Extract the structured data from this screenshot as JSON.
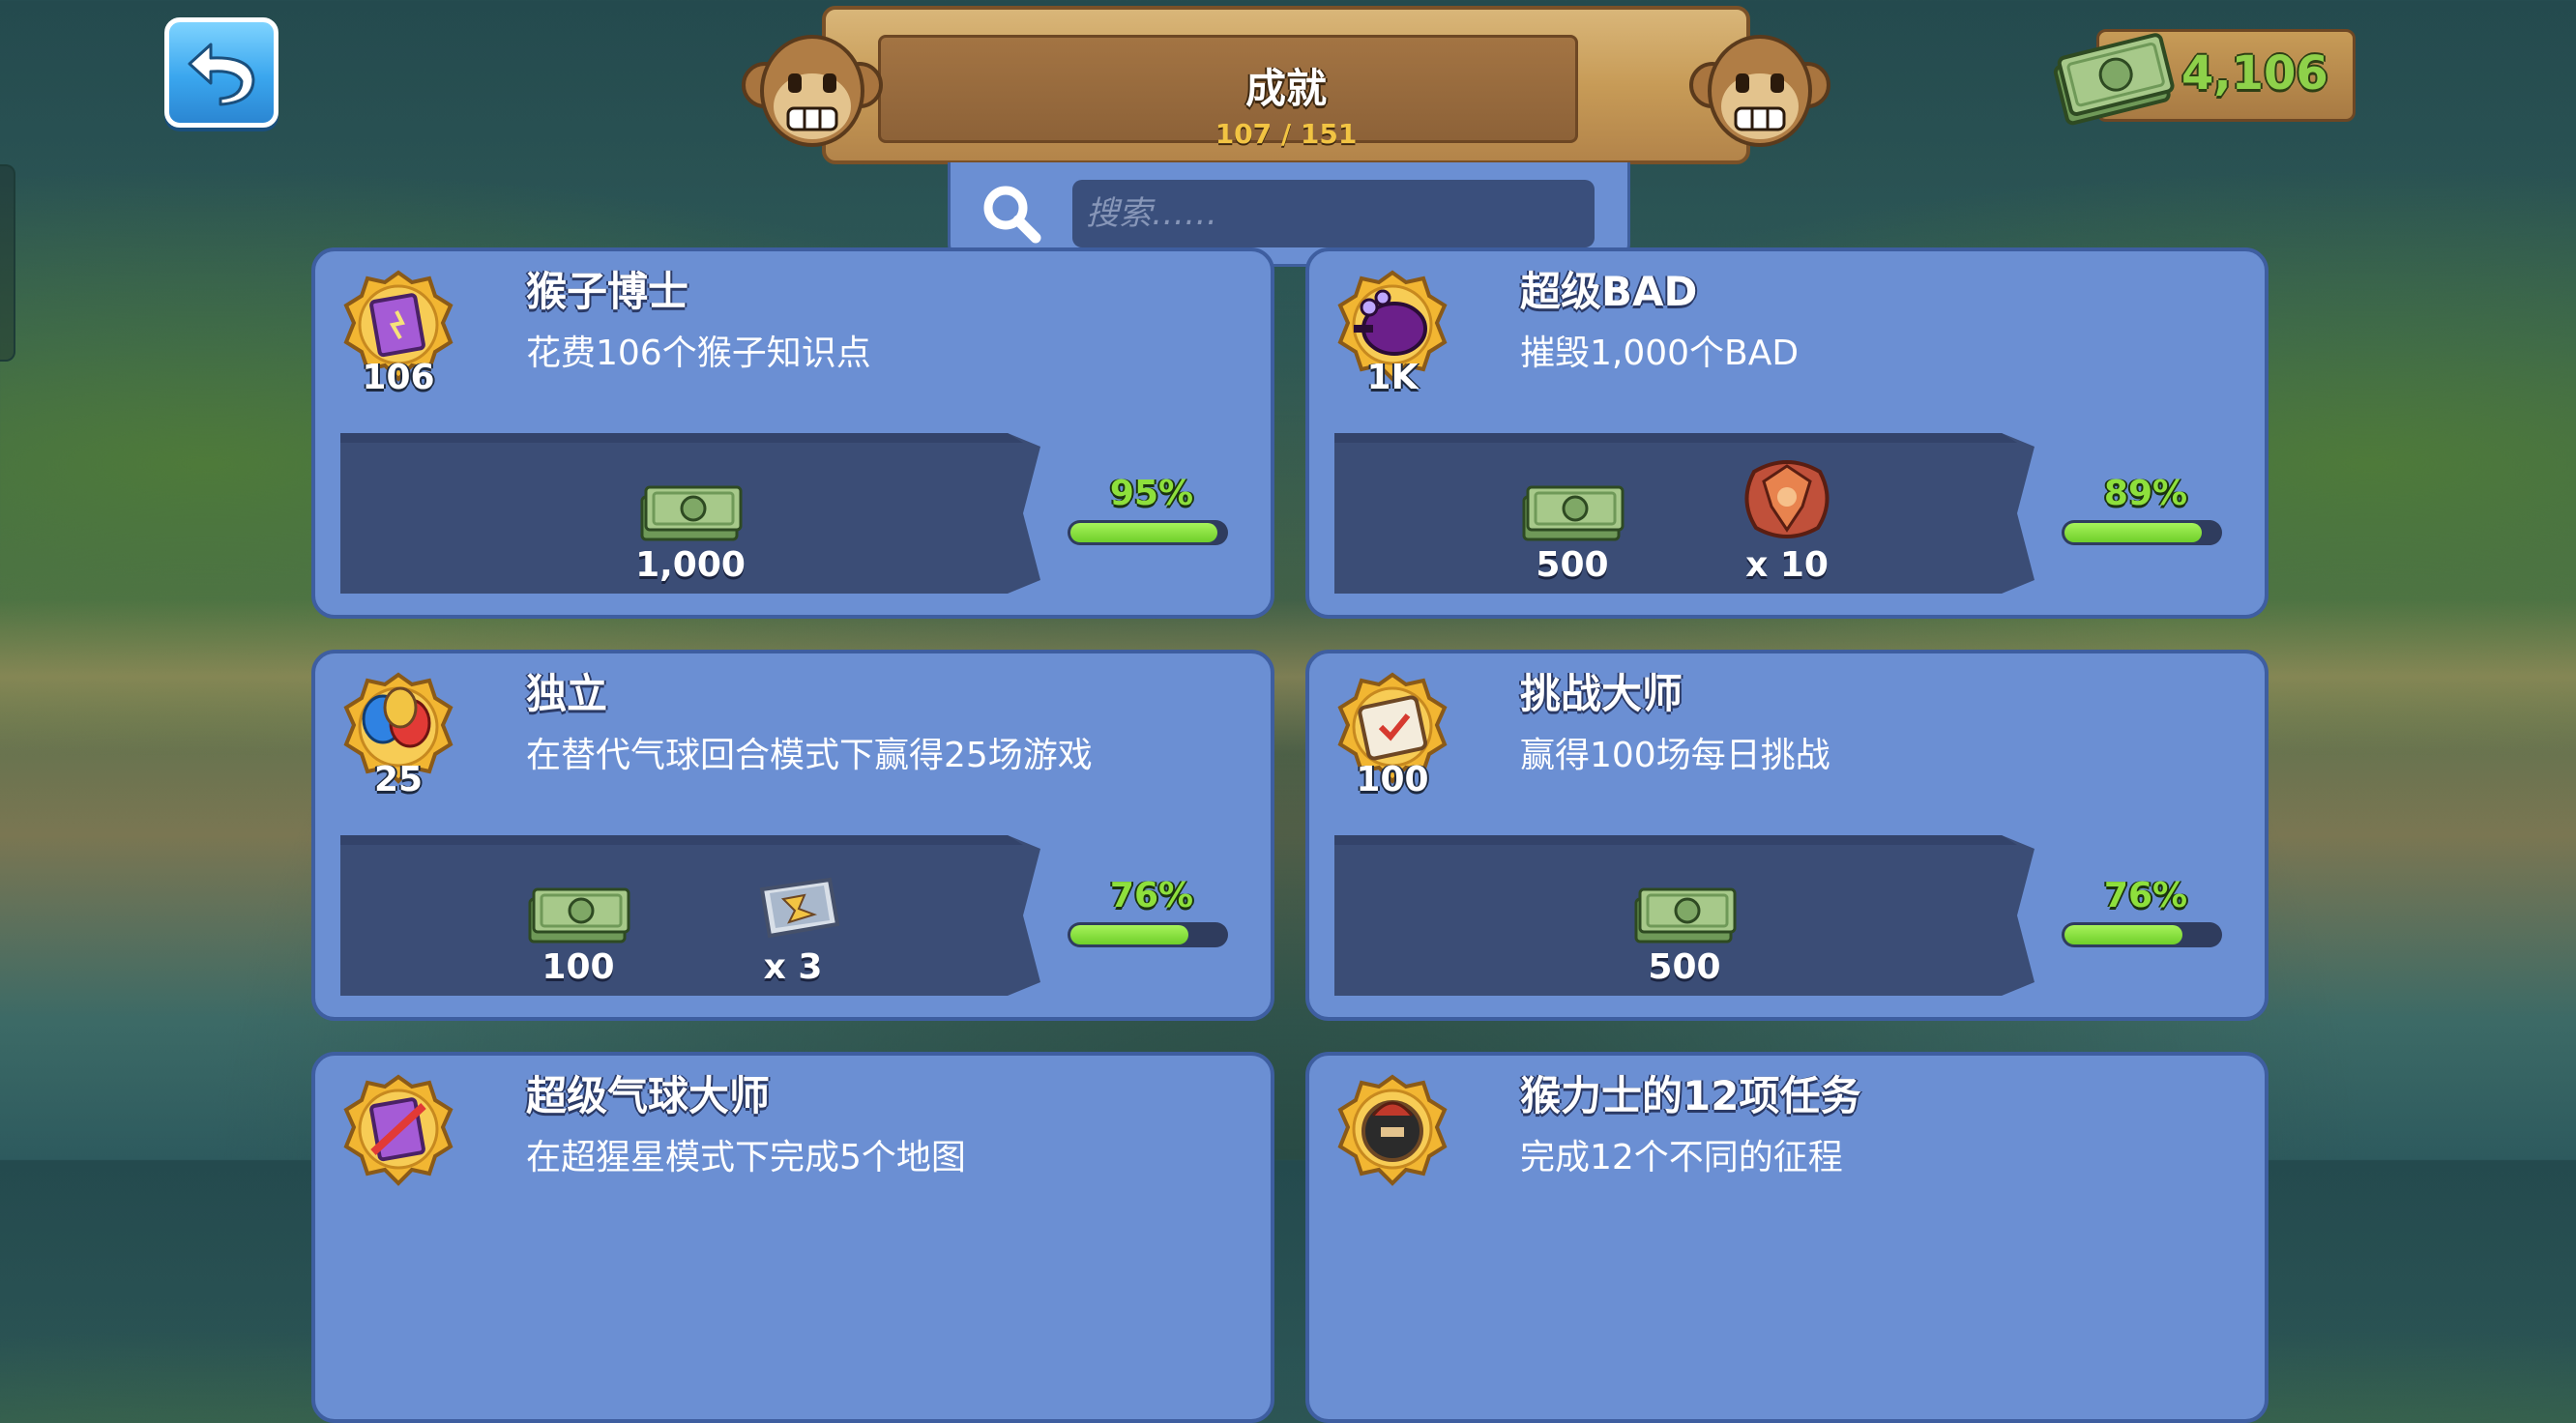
{
  "header": {
    "title": "成就",
    "progress": "107 / 151"
  },
  "search": {
    "placeholder": "搜索……"
  },
  "currency": {
    "amount": "4,106"
  },
  "achievements": [
    {
      "title": "猴子博士",
      "description": "花费106个猴子知识点",
      "medal_label": "106",
      "medal_icon": "knowledge-book-icon",
      "rewards": [
        {
          "icon": "cash-icon",
          "label": "1,000"
        }
      ],
      "percent": "95%",
      "progress": 0.95
    },
    {
      "title": "超级BAD",
      "description": "摧毁1,000个BAD",
      "medal_label": "1K",
      "medal_icon": "bad-blimp-icon",
      "rewards": [
        {
          "icon": "cash-icon",
          "label": "500"
        },
        {
          "icon": "powerup-icon",
          "label": "x 10"
        }
      ],
      "percent": "89%",
      "progress": 0.89
    },
    {
      "title": "独立",
      "description": "在替代气球回合模式下赢得25场游戏",
      "medal_label": "25",
      "medal_icon": "balloons-icon",
      "rewards": [
        {
          "icon": "cash-icon",
          "label": "100"
        },
        {
          "icon": "monkey-boost-icon",
          "label": "x 3"
        }
      ],
      "percent": "76%",
      "progress": 0.76
    },
    {
      "title": "挑战大师",
      "description": "赢得100场每日挑战",
      "medal_label": "100",
      "medal_icon": "calendar-icon",
      "rewards": [
        {
          "icon": "cash-icon",
          "label": "500"
        }
      ],
      "percent": "76%",
      "progress": 0.76
    },
    {
      "title": "超级气球大师",
      "description": "在超猩星模式下完成5个地图",
      "medal_label": "",
      "medal_icon": "map-book-icon",
      "rewards": [],
      "percent": "",
      "progress": null
    },
    {
      "title": "猴力士的12项任务",
      "description": "完成12个不同的征程",
      "medal_label": "",
      "medal_icon": "hero-helmet-icon",
      "rewards": [],
      "percent": "",
      "progress": null
    }
  ],
  "colors": {
    "card_bg": "#6b8fd3",
    "reward_panel": "#3b4d76",
    "progress_green": "#8ee03c",
    "cash_green": "#8ed14a",
    "gold": "#f2c443"
  }
}
